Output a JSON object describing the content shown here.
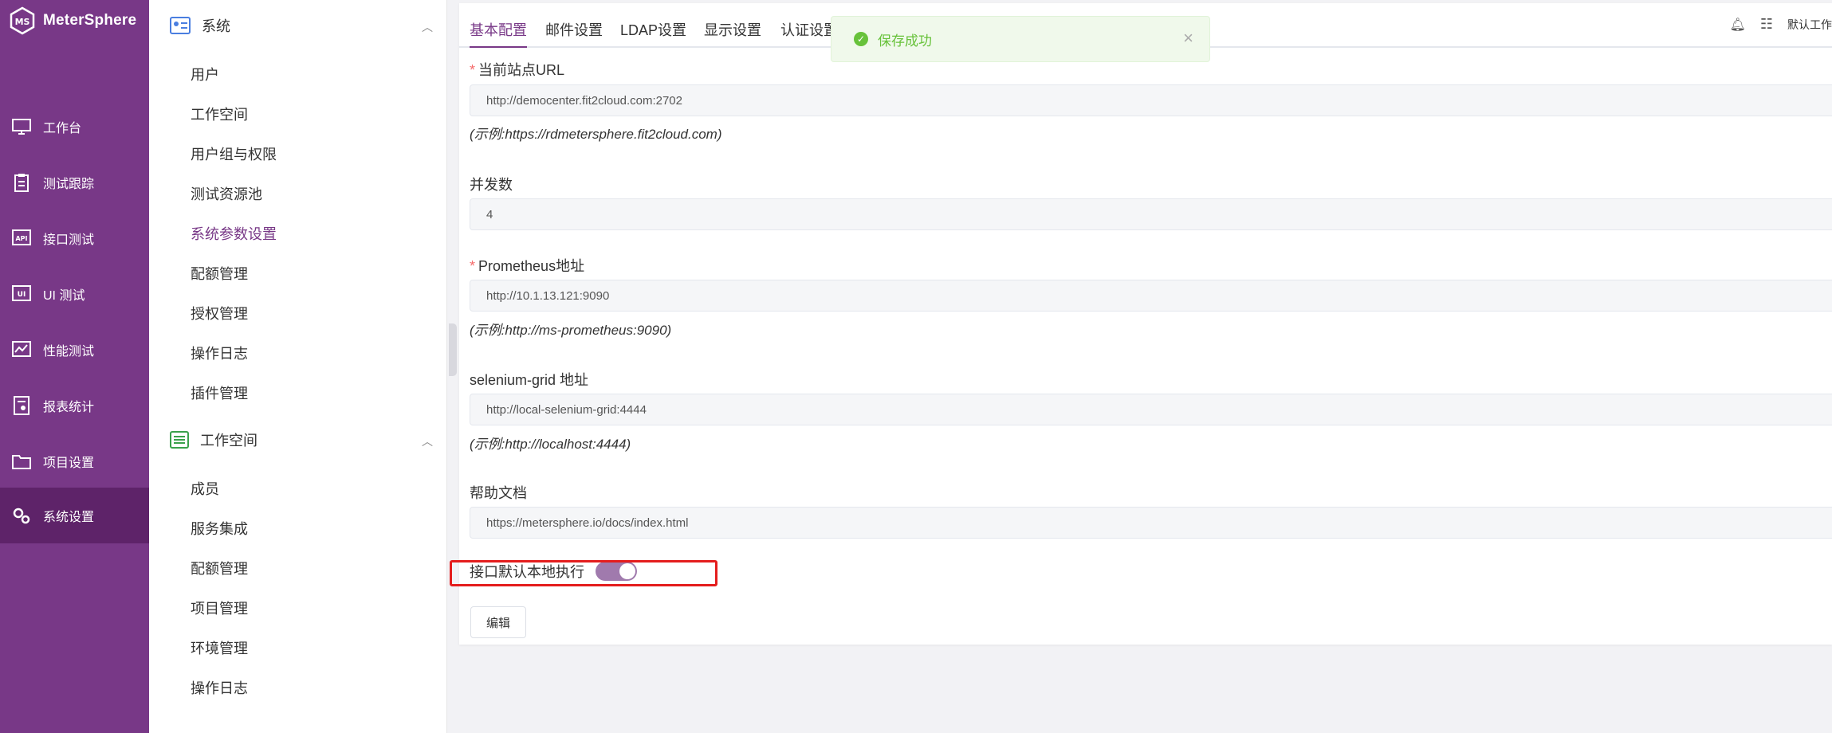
{
  "brand": {
    "name": "MeterSphere"
  },
  "leftnav": {
    "items": [
      {
        "label": "工作台",
        "icon": "monitor-icon"
      },
      {
        "label": "测试跟踪",
        "icon": "clipboard-icon"
      },
      {
        "label": "接口测试",
        "icon": "api-icon"
      },
      {
        "label": "UI 测试",
        "icon": "ui-icon"
      },
      {
        "label": "性能测试",
        "icon": "performance-icon"
      },
      {
        "label": "报表统计",
        "icon": "report-icon"
      },
      {
        "label": "项目设置",
        "icon": "folder-icon"
      },
      {
        "label": "系统设置",
        "icon": "gears-icon"
      }
    ]
  },
  "submenu": {
    "system": {
      "title": "系统",
      "items": [
        "用户",
        "工作空间",
        "用户组与权限",
        "测试资源池",
        "系统参数设置",
        "配额管理",
        "授权管理",
        "操作日志",
        "插件管理"
      ]
    },
    "workspace": {
      "title": "工作空间",
      "items": [
        "成员",
        "服务集成",
        "配额管理",
        "项目管理",
        "环境管理",
        "操作日志"
      ]
    }
  },
  "tabs": [
    "基本配置",
    "邮件设置",
    "LDAP设置",
    "显示设置",
    "认证设置"
  ],
  "header": {
    "workspace": "默认工作"
  },
  "toast": {
    "message": "保存成功"
  },
  "form": {
    "site_url": {
      "label": "当前站点URL",
      "value": "http://democenter.fit2cloud.com:2702",
      "hint": "(示例:https://rdmetersphere.fit2cloud.com)"
    },
    "concurrency": {
      "label": "并发数",
      "value": "4"
    },
    "prometheus": {
      "label": "Prometheus地址",
      "value": "http://10.1.13.121:9090",
      "hint": "(示例:http://ms-prometheus:9090)"
    },
    "selenium": {
      "label": "selenium-grid 地址",
      "value": "http://local-selenium-grid:4444",
      "hint": "(示例:http://localhost:4444)"
    },
    "help_doc": {
      "label": "帮助文档",
      "value": "https://metersphere.io/docs/index.html"
    },
    "local_exec": {
      "label": "接口默认本地执行",
      "enabled": true
    },
    "edit_label": "编辑"
  },
  "colors": {
    "primary": "#783887",
    "nav_active": "#5e2369",
    "success": "#67c23a",
    "highlight": "#e41d1d"
  }
}
